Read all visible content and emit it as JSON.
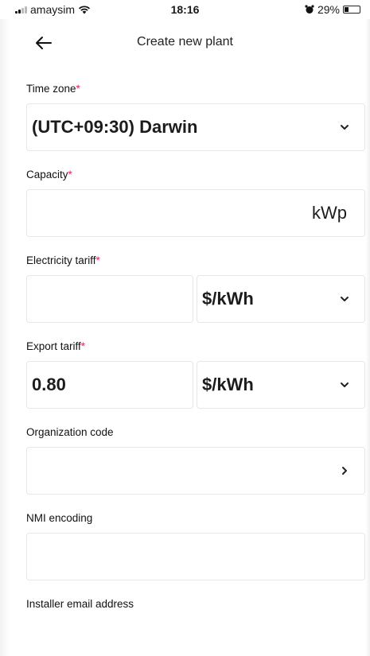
{
  "status_bar": {
    "carrier": "amaysim",
    "time": "18:16",
    "battery": "29%",
    "battery_level": 0.29
  },
  "header": {
    "title": "Create new plant"
  },
  "fields": {
    "time_zone": {
      "label": "Time zone",
      "required": "*",
      "value": "(UTC+09:30) Darwin"
    },
    "capacity": {
      "label": "Capacity",
      "required": "*",
      "value": "",
      "unit": "kWp"
    },
    "electricity_tariff": {
      "label": "Electricity tariff",
      "required": "*",
      "value": "",
      "unit": "$/kWh"
    },
    "export_tariff": {
      "label": "Export tariff",
      "required": "*",
      "value": "0.80",
      "unit": "$/kWh"
    },
    "organization_code": {
      "label": "Organization code",
      "value": ""
    },
    "nmi_encoding": {
      "label": "NMI encoding",
      "value": ""
    },
    "installer_email": {
      "label": "Installer email address"
    }
  }
}
